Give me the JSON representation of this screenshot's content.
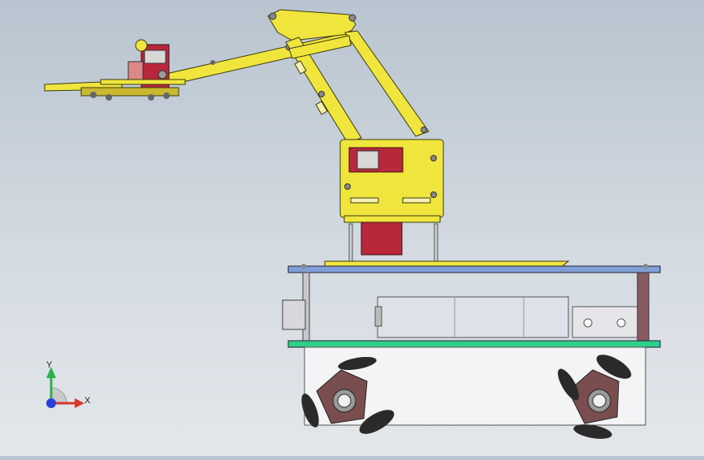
{
  "viewport": {
    "background_top": "#b8c4cf",
    "background_bottom": "#e3e7eb"
  },
  "triad": {
    "x_axis": "X",
    "y_axis": "Y",
    "x_color": "#d63a2a",
    "y_color": "#2bb34a",
    "z_color": "#2a3fd6"
  },
  "model": {
    "arm_color": "#f0e53c",
    "servo_color": "#b8283a",
    "deck_blue": "#7f9fd6",
    "deck_green": "#2fcf8a",
    "chassis_color": "#f4f4f6",
    "wheel_hub_color": "#7a4e4e",
    "roller_color": "#2a2a2a",
    "battery_color": "#dfe1ea"
  }
}
